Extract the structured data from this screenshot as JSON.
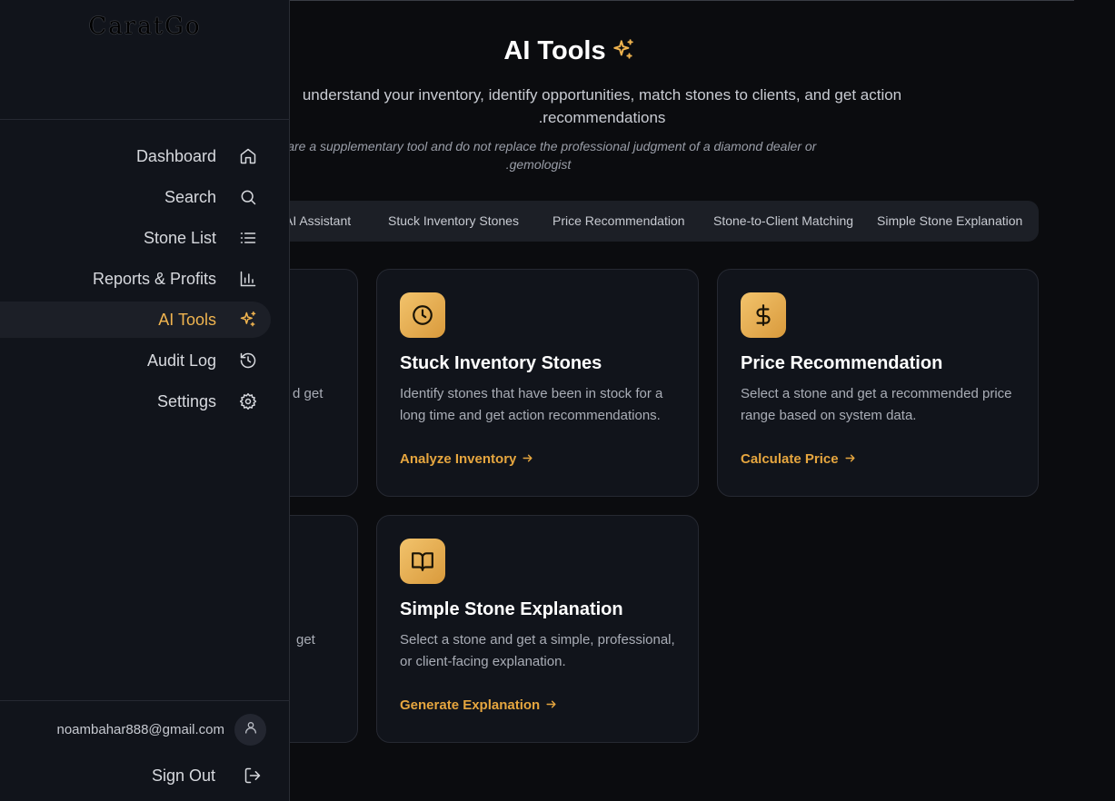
{
  "app": {
    "logo": "CaratGo"
  },
  "page": {
    "title": "AI Tools",
    "subtitle_line1": "understand your inventory, identify opportunities, match stones to clients, and get action",
    "subtitle_line2": ".recommendations",
    "disclaimer_line1": "ions are a supplementary tool and do not replace the professional judgment of a diamond dealer or",
    "disclaimer_line2": ".gemologist"
  },
  "tabs": [
    {
      "label": "AI Assistant"
    },
    {
      "label": "Stuck Inventory Stones"
    },
    {
      "label": "Price Recommendation"
    },
    {
      "label": "Stone-to-Client Matching"
    },
    {
      "label": "Simple Stone Explanation"
    }
  ],
  "cards": {
    "stuck": {
      "title": "Stuck Inventory Stones",
      "desc": "Identify stones that have been in stock for a long time and get action recommendations.",
      "link": "Analyze Inventory",
      "icon": "clock-icon"
    },
    "price": {
      "title": "Price Recommendation",
      "desc": "Select a stone and get a recommended price range based on system data.",
      "link": "Calculate Price",
      "icon": "dollar-icon"
    },
    "explain": {
      "title": "Simple Stone Explanation",
      "desc": "Select a stone and get a simple, professional, or client-facing explanation.",
      "link": "Generate Explanation",
      "icon": "book-open-icon"
    },
    "partial_top_text": "d get",
    "partial_bottom_text": "get"
  },
  "sidebar": {
    "items": [
      {
        "label": "Dashboard",
        "icon": "home-icon"
      },
      {
        "label": "Search",
        "icon": "search-icon"
      },
      {
        "label": "Stone List",
        "icon": "list-icon"
      },
      {
        "label": "Reports & Profits",
        "icon": "bar-chart-icon"
      },
      {
        "label": "AI Tools",
        "icon": "sparkles-icon",
        "active": true
      },
      {
        "label": "Audit Log",
        "icon": "history-icon"
      },
      {
        "label": "Settings",
        "icon": "gear-icon"
      }
    ],
    "user_email": "noambahar888@gmail.com",
    "sign_out": "Sign Out"
  },
  "colors": {
    "accent": "#f0b44f",
    "background": "#0b0c0f",
    "panel": "#11141b"
  }
}
